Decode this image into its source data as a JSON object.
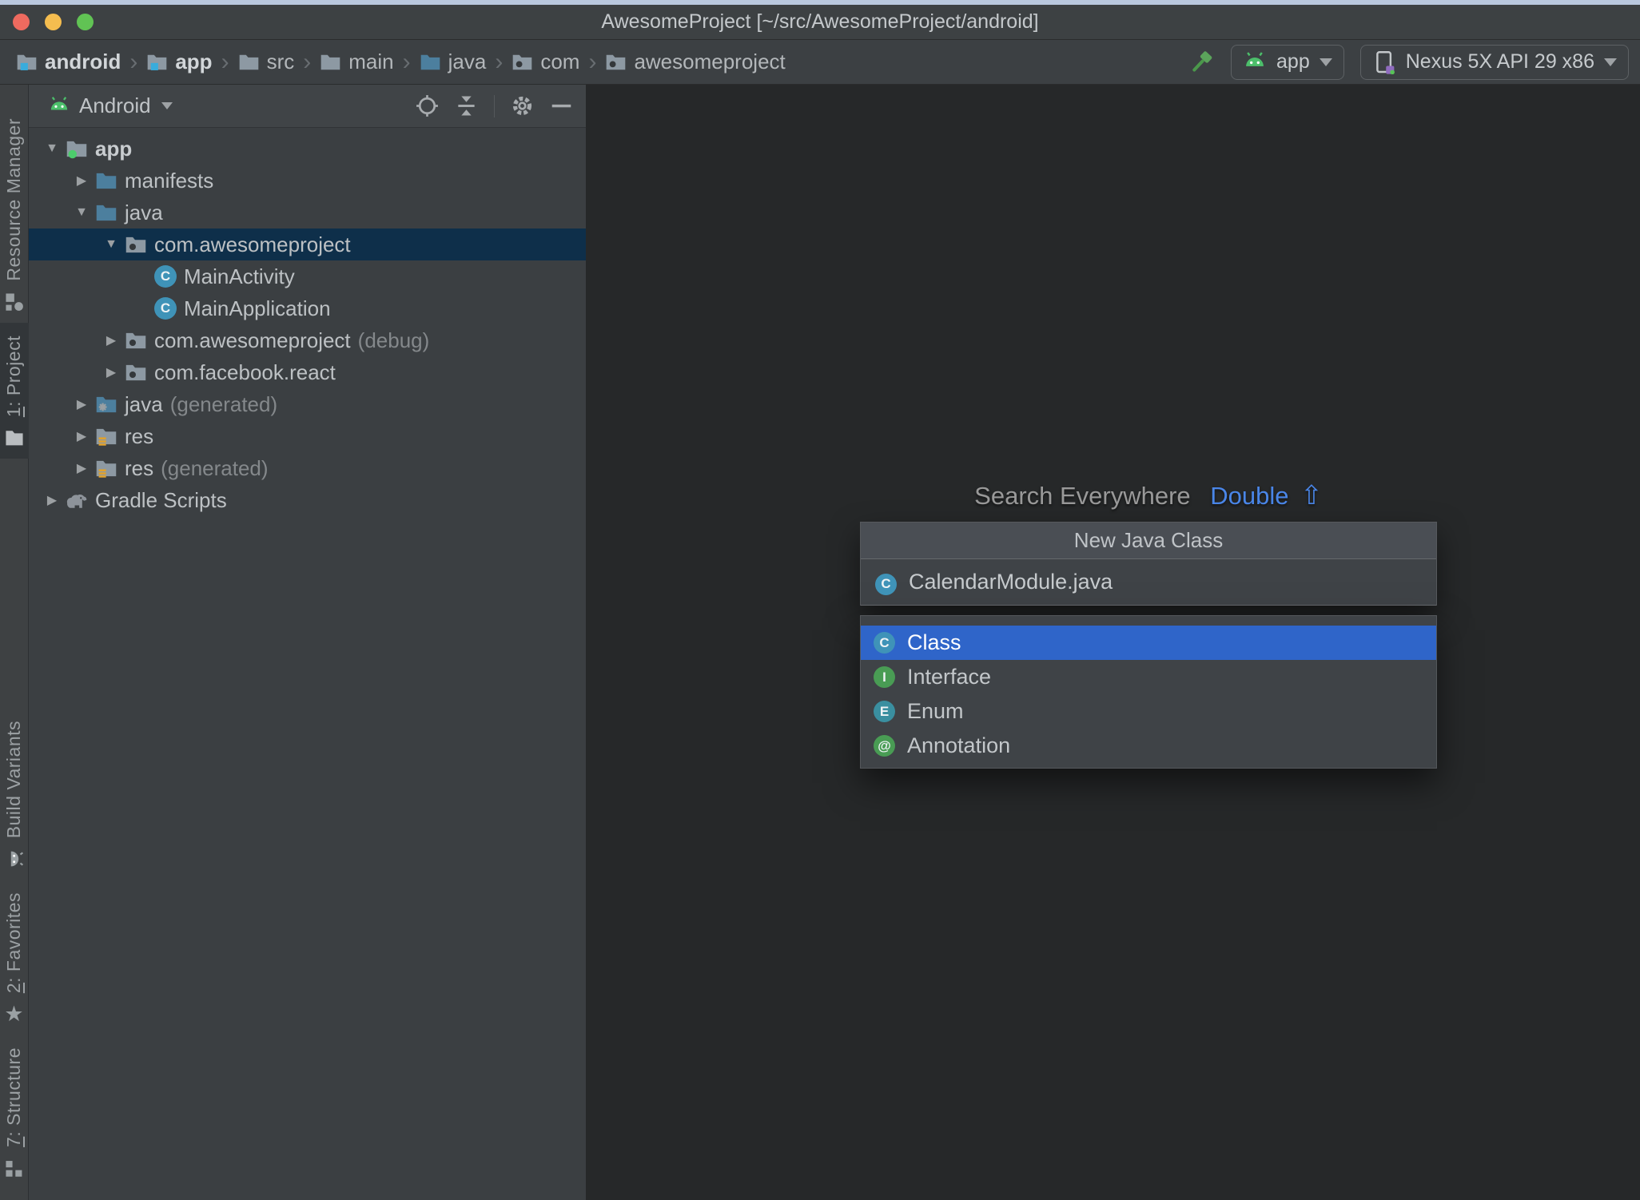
{
  "window": {
    "title": "AwesomeProject [~/src/AwesomeProject/android]"
  },
  "breadcrumbs": {
    "items": [
      {
        "label": "android",
        "icon": "module-folder-icon",
        "bold": true
      },
      {
        "label": "app",
        "icon": "module-folder-icon",
        "bold": true
      },
      {
        "label": "src",
        "icon": "folder-icon",
        "bold": false
      },
      {
        "label": "main",
        "icon": "folder-icon",
        "bold": false
      },
      {
        "label": "java",
        "icon": "source-folder-icon",
        "bold": false
      },
      {
        "label": "com",
        "icon": "package-icon",
        "bold": false
      },
      {
        "label": "awesomeproject",
        "icon": "package-icon",
        "bold": false
      }
    ]
  },
  "toolbar": {
    "build_icon": "hammer-icon",
    "run_config": {
      "label": "app",
      "icon": "android-icon"
    },
    "device": {
      "label": "Nexus 5X API 29 x86",
      "icon": "device-icon"
    }
  },
  "sidebar": {
    "top": [
      {
        "mnemonic": "",
        "label": "Resource Manager",
        "icon": "resource-manager-icon",
        "active": false
      },
      {
        "mnemonic": "1",
        "label": ": Project",
        "icon": "project-icon",
        "active": true
      }
    ],
    "bottom": [
      {
        "mnemonic": "",
        "label": "Build Variants",
        "icon": "build-variants-icon",
        "active": false
      },
      {
        "mnemonic": "2",
        "label": ": Favorites",
        "icon": "favorites-icon",
        "active": false
      },
      {
        "mnemonic": "7",
        "label": ": Structure",
        "icon": "structure-icon",
        "active": false
      }
    ]
  },
  "project_panel": {
    "view_selector": {
      "label": "Android",
      "icon": "android-icon"
    },
    "header_actions": [
      "locate-icon",
      "collapse-all-icon",
      "separator",
      "settings-icon",
      "hide-icon"
    ],
    "tree": [
      {
        "label": "app",
        "suffix": "",
        "icon": "app-module-folder-icon",
        "level": 0,
        "arrow": "expanded",
        "bold": true,
        "selected": false
      },
      {
        "label": "manifests",
        "suffix": "",
        "icon": "source-folder-icon",
        "level": 1,
        "arrow": "collapsed",
        "bold": false,
        "selected": false
      },
      {
        "label": "java",
        "suffix": "",
        "icon": "source-folder-icon",
        "level": 1,
        "arrow": "expanded",
        "bold": false,
        "selected": false
      },
      {
        "label": "com.awesomeproject",
        "suffix": "",
        "icon": "package-icon",
        "level": 2,
        "arrow": "expanded",
        "bold": false,
        "selected": true
      },
      {
        "label": "MainActivity",
        "suffix": "",
        "icon": "class-icon",
        "level": 3,
        "arrow": "none",
        "bold": false,
        "selected": false
      },
      {
        "label": "MainApplication",
        "suffix": "",
        "icon": "class-icon",
        "level": 3,
        "arrow": "none",
        "bold": false,
        "selected": false
      },
      {
        "label": "com.awesomeproject",
        "suffix": "(debug)",
        "icon": "package-icon",
        "level": 2,
        "arrow": "collapsed",
        "bold": false,
        "selected": false
      },
      {
        "label": "com.facebook.react",
        "suffix": "",
        "icon": "package-icon",
        "level": 2,
        "arrow": "collapsed",
        "bold": false,
        "selected": false
      },
      {
        "label": "java",
        "suffix": "(generated)",
        "icon": "generated-source-folder-icon",
        "level": 1,
        "arrow": "collapsed",
        "bold": false,
        "selected": false
      },
      {
        "label": "res",
        "suffix": "",
        "icon": "res-folder-icon",
        "level": 1,
        "arrow": "collapsed",
        "bold": false,
        "selected": false
      },
      {
        "label": "res",
        "suffix": "(generated)",
        "icon": "res-folder-icon",
        "level": 1,
        "arrow": "collapsed",
        "bold": false,
        "selected": false
      },
      {
        "label": "Gradle Scripts",
        "suffix": "",
        "icon": "gradle-icon",
        "level": 0,
        "arrow": "collapsed",
        "bold": false,
        "selected": false
      }
    ]
  },
  "editor": {
    "hint": {
      "text": "Search Everywhere",
      "shortcut": "Double",
      "shortcut_icon": "shift-icon"
    }
  },
  "popup": {
    "title": "New Java Class",
    "filename": "CalendarModule.java",
    "filename_icon": "class-icon",
    "items": [
      {
        "label": "Class",
        "icon": "class-icon",
        "selected": true
      },
      {
        "label": "Interface",
        "icon": "interface-icon",
        "selected": false
      },
      {
        "label": "Enum",
        "icon": "enum-icon",
        "selected": false
      },
      {
        "label": "Annotation",
        "icon": "annotation-icon",
        "selected": false
      }
    ]
  },
  "colors": {
    "list_selection_blue": "#2f65c9",
    "tree_selection_navy": "#0e2f4a",
    "hint_shortcut_blue": "#4a86e8",
    "class_icon_teal": "#3f93b8",
    "enum_icon_teal": "#3a8fa0",
    "interface_icon_green": "#499c54",
    "annotation_icon_green": "#499c54",
    "android_green": "#4cbf6b",
    "hammer_green": "#5ba35b",
    "folder_gray": "#8d99a3",
    "folder_blue": "#4c7f9e",
    "res_badge_orange": "#e0a22e",
    "module_badge_blue": "#38acdc",
    "app_badge_green": "#4ccc6c"
  }
}
